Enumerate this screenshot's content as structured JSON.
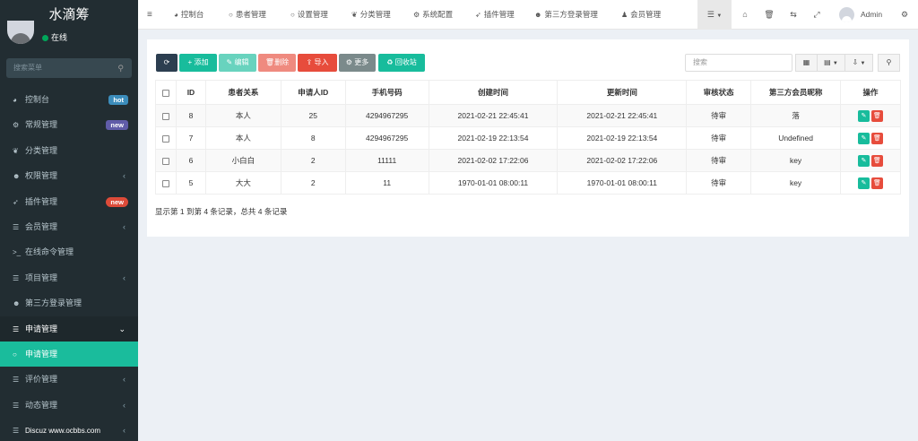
{
  "sidebar": {
    "logo": "水滴筹",
    "status": "在线",
    "search_placeholder": "搜索菜单",
    "items": [
      {
        "label": "控制台",
        "icon": "dashboard-icon",
        "badge": "hot",
        "badge_color": "#3c8dbc"
      },
      {
        "label": "常规管理",
        "icon": "cogs-icon",
        "badge": "new",
        "badge_color": "#605ca8"
      },
      {
        "label": "分类管理",
        "icon": "leaf-icon"
      },
      {
        "label": "权限管理",
        "icon": "group-icon",
        "arrow": "‹"
      },
      {
        "label": "插件管理",
        "icon": "rocket-icon",
        "badge": "new",
        "badge_color": "#dd4b39"
      },
      {
        "label": "会员管理",
        "icon": "list-icon",
        "arrow": "‹"
      },
      {
        "label": "在线命令管理",
        "icon": "terminal-icon"
      },
      {
        "label": "项目管理",
        "icon": "list-icon",
        "arrow": "‹"
      },
      {
        "label": "第三方登录管理",
        "icon": "group-icon"
      },
      {
        "label": "申请管理",
        "icon": "list-icon",
        "arrow": "⌄"
      },
      {
        "label": "申请管理",
        "icon": "circle-icon"
      },
      {
        "label": "评价管理",
        "icon": "list-icon",
        "arrow": "‹"
      },
      {
        "label": "动态管理",
        "icon": "list-icon",
        "arrow": "‹"
      },
      {
        "label": "Discuz  www.ocbbs.com",
        "icon": "list-icon",
        "arrow": "‹"
      }
    ]
  },
  "navbar": {
    "items": [
      {
        "label": "控制台",
        "icon": "dashboard-icon"
      },
      {
        "label": "患者管理",
        "icon": "circle-icon"
      },
      {
        "label": "设置管理",
        "icon": "circle-icon"
      },
      {
        "label": "分类管理",
        "icon": "leaf-icon"
      },
      {
        "label": "系统配置",
        "icon": "cog-icon"
      },
      {
        "label": "插件管理",
        "icon": "rocket-icon"
      },
      {
        "label": "第三方登录管理",
        "icon": "group-icon"
      },
      {
        "label": "会员管理",
        "icon": "user-icon"
      }
    ],
    "admin": "Admin"
  },
  "toolbar": {
    "add": "添加",
    "edit": "编辑",
    "delete": "删除",
    "import": "导入",
    "more": "更多",
    "recycle": "回收站",
    "search_placeholder": "搜索"
  },
  "table": {
    "headers": [
      "ID",
      "患者关系",
      "申请人ID",
      "手机号码",
      "创建时间",
      "更新时间",
      "审核状态",
      "第三方会员昵称",
      "操作"
    ],
    "rows": [
      [
        "8",
        "本人",
        "25",
        "4294967295",
        "2021-02-21 22:45:41",
        "2021-02-21 22:45:41",
        "待审",
        "落"
      ],
      [
        "7",
        "本人",
        "8",
        "4294967295",
        "2021-02-19 22:13:54",
        "2021-02-19 22:13:54",
        "待审",
        "Undefined"
      ],
      [
        "6",
        "小白白",
        "2",
        "11111",
        "2021-02-02 17:22:06",
        "2021-02-02 17:22:06",
        "待审",
        "key"
      ],
      [
        "5",
        "大大",
        "2",
        "11",
        "1970-01-01 08:00:11",
        "1970-01-01 08:00:11",
        "待审",
        "key"
      ]
    ]
  },
  "pager": {
    "summary": "显示第 1 到第 4 条记录，总共 4 条记录"
  },
  "colors": {
    "sidebar_bg": "#222d32",
    "accent": "#18bc9c",
    "active_menu": "#1abc9c",
    "danger": "#e74c3c",
    "dark": "#2c3e50"
  }
}
